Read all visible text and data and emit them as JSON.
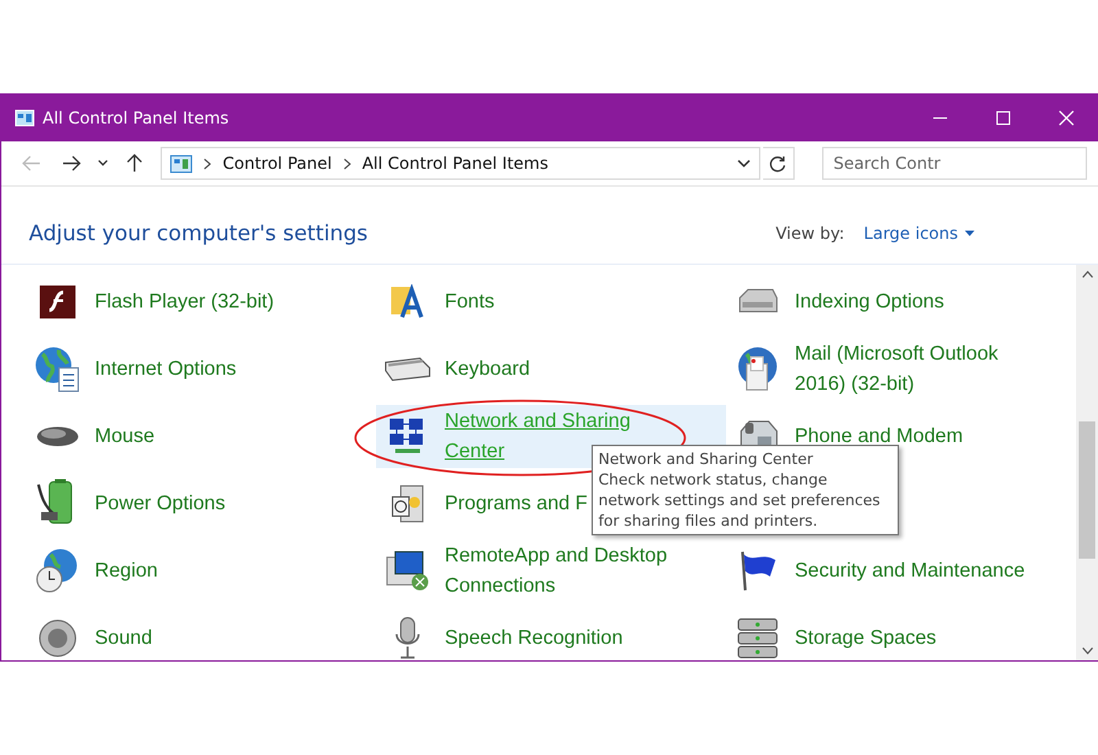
{
  "window": {
    "title": "All Control Panel Items"
  },
  "navigation": {
    "back_disabled": true,
    "forward_disabled": false
  },
  "address_bar": {
    "breadcrumbs": [
      "Control Panel",
      "All Control Panel Items"
    ]
  },
  "search": {
    "placeholder": "Search Contr"
  },
  "heading": "Adjust your computer's settings",
  "view_by": {
    "label": "View by:",
    "value": "Large icons"
  },
  "rows": [
    {
      "items": [
        {
          "label": "Flash Player (32-bit)",
          "selected": false
        },
        {
          "label": "Fonts",
          "selected": false
        },
        {
          "label": "Indexing Options",
          "selected": false
        }
      ]
    },
    {
      "items": [
        {
          "label": "Internet Options",
          "selected": false
        },
        {
          "label": "Keyboard",
          "selected": false
        },
        {
          "label": "Mail (Microsoft Outlook 2016) (32-bit)",
          "selected": false
        }
      ]
    },
    {
      "items": [
        {
          "label": "Mouse",
          "selected": false
        },
        {
          "label": "Network and Sharing Center",
          "selected": true
        },
        {
          "label": "Phone and Modem",
          "selected": false
        }
      ]
    },
    {
      "items": [
        {
          "label": "Power Options",
          "selected": false
        },
        {
          "label": "Programs and F",
          "selected": false
        }
      ]
    },
    {
      "items": [
        {
          "label": "Region",
          "selected": false
        },
        {
          "label": "RemoteApp and Desktop Connections",
          "selected": false
        },
        {
          "label": "Security and Maintenance",
          "selected": false
        }
      ]
    },
    {
      "items": [
        {
          "label": "Sound",
          "selected": false
        },
        {
          "label": "Speech Recognition",
          "selected": false
        },
        {
          "label": "Storage Spaces",
          "selected": false
        }
      ]
    }
  ],
  "tooltip": {
    "title": "Network and Sharing Center",
    "text": "Check network status, change network settings and set preferences for sharing files and printers."
  }
}
